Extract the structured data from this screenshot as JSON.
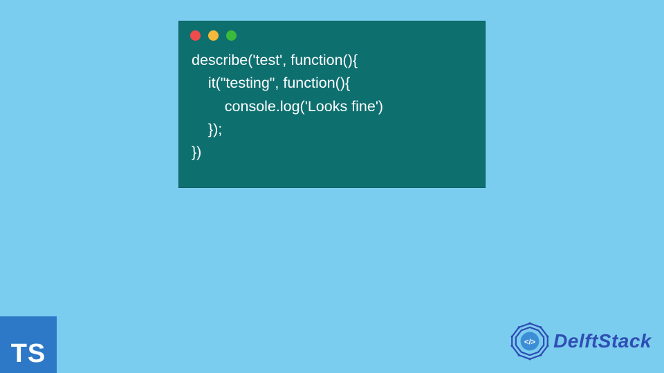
{
  "window": {
    "buttons": [
      "close",
      "minimize",
      "zoom"
    ]
  },
  "code": {
    "lines": [
      "describe('test', function(){",
      "    it(\"testing\", function(){",
      "        console.log('Looks fine')",
      "    });",
      "})"
    ]
  },
  "ts_badge": {
    "label": "TS"
  },
  "brand": {
    "name": "DelftStack",
    "icon": "code-emblem-icon"
  },
  "colors": {
    "background": "#7bcdf0",
    "code_window": "#0e6f6f",
    "ts_badge": "#2d79c7",
    "brand_text": "#2f4db3"
  }
}
